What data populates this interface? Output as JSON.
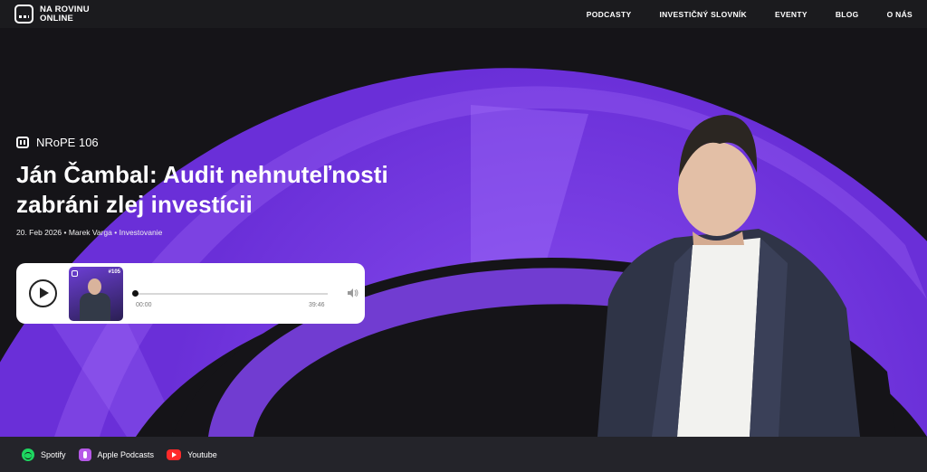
{
  "brand": {
    "line1": "NA ROVINU",
    "line2": "ONLINE"
  },
  "nav": [
    "PODCASTY",
    "INVESTIČNÝ SLOVNÍK",
    "EVENTY",
    "BLOG",
    "O NÁS"
  ],
  "episode": {
    "code": "NRoPE 106",
    "title_line1": "Ján Čambal: Audit nehnuteľnosti",
    "title_line2": "zabráni zlej investícii",
    "date": "20. Feb 2026",
    "author": "Marek Varga",
    "category": "Investovanie",
    "separator": "•"
  },
  "player": {
    "cover_badge": "#105",
    "current_time": "00:00",
    "duration": "39:46",
    "progress": 0
  },
  "platforms": [
    {
      "label": "Spotify",
      "icon": "spotify-icon"
    },
    {
      "label": "Apple Podcasts",
      "icon": "apple-podcasts-icon"
    },
    {
      "label": "Youtube",
      "icon": "youtube-icon"
    }
  ],
  "colors": {
    "accent": "#7a3ee6",
    "accent_light": "#9a5cf7",
    "background": "#151418"
  }
}
